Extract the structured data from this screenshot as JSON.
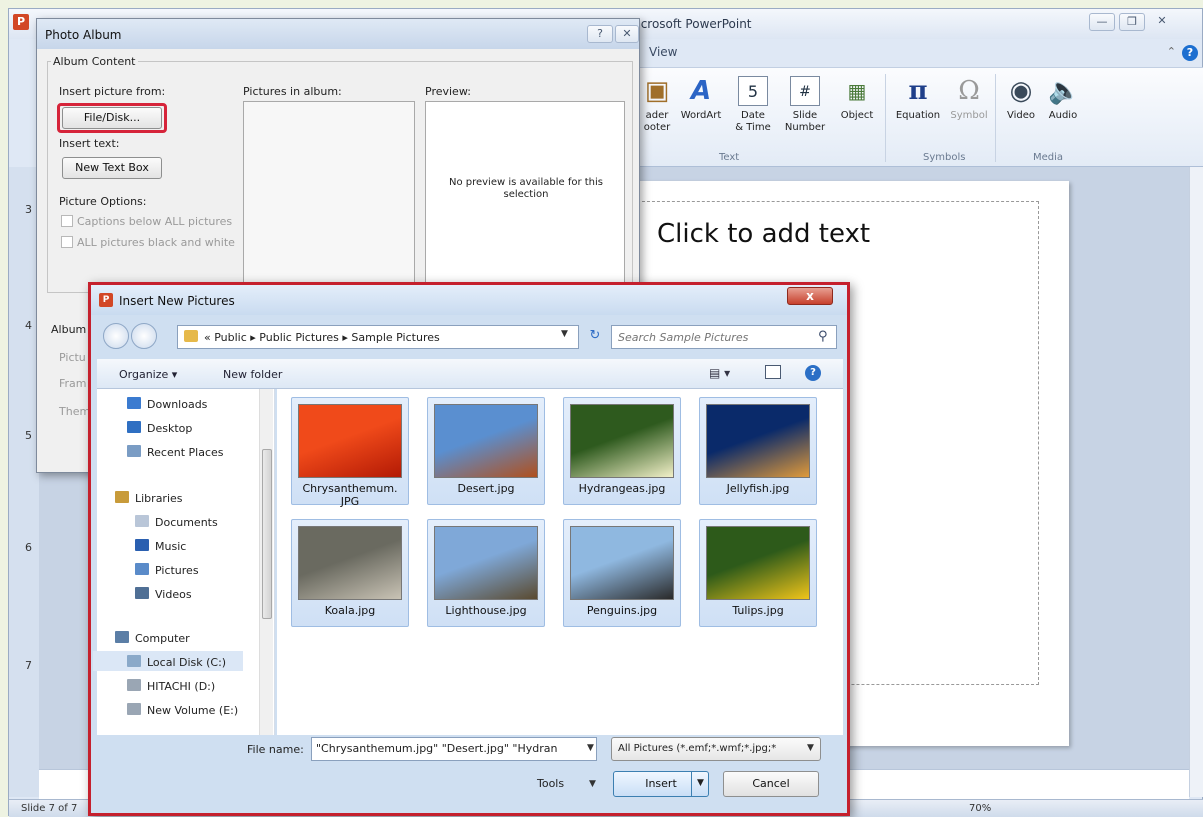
{
  "ppt": {
    "app_icon": "P",
    "title": "Microsoft PowerPoint",
    "view_tab": "View",
    "ribbon": {
      "header_footer": "ader\nooter",
      "wordart": "WordArt",
      "date_time": "Date\n& Time",
      "slide_number": "Slide\nNumber",
      "object": "Object",
      "equation": "Equation",
      "symbol": "Symbol",
      "video": "Video",
      "audio": "Audio",
      "group_text": "Text",
      "group_symbols": "Symbols",
      "group_media": "Media"
    },
    "slide_numbers": [
      "3",
      "4",
      "5",
      "6",
      "7"
    ],
    "slide_placeholder": "Click to add text",
    "status": "Slide 7 of 7",
    "zoom": "70%"
  },
  "photo_album": {
    "title": "Photo Album",
    "album_content": "Album Content",
    "insert_picture_from": "Insert picture from:",
    "file_disk_button": "File/Disk...",
    "insert_text": "Insert text:",
    "new_text_box_button": "New Text Box",
    "picture_options": "Picture Options:",
    "captions_option": "Captions below ALL pictures",
    "black_white_option": "ALL pictures black and white",
    "pictures_in_album": "Pictures in album:",
    "preview": "Preview:",
    "no_preview": "No preview is available for this selection",
    "album_layout_partial": "Album",
    "picture_layout_partial": "Pictu",
    "frame_partial": "Fram",
    "theme_partial": "Them"
  },
  "insert_dialog": {
    "icon": "P",
    "title": "Insert New Pictures",
    "close": "x",
    "address": "« Public ▸ Public Pictures ▸ Sample Pictures",
    "search_placeholder": "Search Sample Pictures",
    "organize": "Organize ▾",
    "new_folder": "New folder",
    "nav_items": [
      {
        "label": "Downloads",
        "color": "#3b7bd0"
      },
      {
        "label": "Desktop",
        "color": "#2f6fc2"
      },
      {
        "label": "Recent Places",
        "color": "#7a9cc4"
      },
      {
        "label": "Libraries",
        "color": "#c89b3a"
      },
      {
        "label": "Documents",
        "color": "#b9c6d8"
      },
      {
        "label": "Music",
        "color": "#2a5fb0"
      },
      {
        "label": "Pictures",
        "color": "#5a8bc9"
      },
      {
        "label": "Videos",
        "color": "#4f6f95"
      },
      {
        "label": "Computer",
        "color": "#5b7ea6"
      },
      {
        "label": "Local Disk (C:)",
        "color": "#8aa9c9"
      },
      {
        "label": "HITACHI (D:)",
        "color": "#9aa6b4"
      },
      {
        "label": "New Volume (E:)",
        "color": "#9aa6b4"
      }
    ],
    "files": [
      {
        "name": "Chrysanthemum.\nJPG",
        "c1": "#f04a1a",
        "c2": "#b31a05"
      },
      {
        "name": "Desert.jpg",
        "c1": "#5a8fd0",
        "c2": "#b0501e"
      },
      {
        "name": "Hydrangeas.jpg",
        "c1": "#2e5a1e",
        "c2": "#f2f0c8"
      },
      {
        "name": "Jellyfish.jpg",
        "c1": "#0a2a6a",
        "c2": "#e09a3a"
      },
      {
        "name": "Koala.jpg",
        "c1": "#6a6a60",
        "c2": "#c9c3b5"
      },
      {
        "name": "Lighthouse.jpg",
        "c1": "#7fa8d8",
        "c2": "#5a4a30"
      },
      {
        "name": "Penguins.jpg",
        "c1": "#8fb8e0",
        "c2": "#2a2a2a"
      },
      {
        "name": "Tulips.jpg",
        "c1": "#2d5a1a",
        "c2": "#f0c41a"
      }
    ],
    "file_name_label": "File name:",
    "file_name_value": "\"Chrysanthemum.jpg\" \"Desert.jpg\" \"Hydran",
    "file_type": "All Pictures (*.emf;*.wmf;*.jpg;*",
    "tools": "Tools",
    "insert": "Insert",
    "cancel": "Cancel"
  }
}
